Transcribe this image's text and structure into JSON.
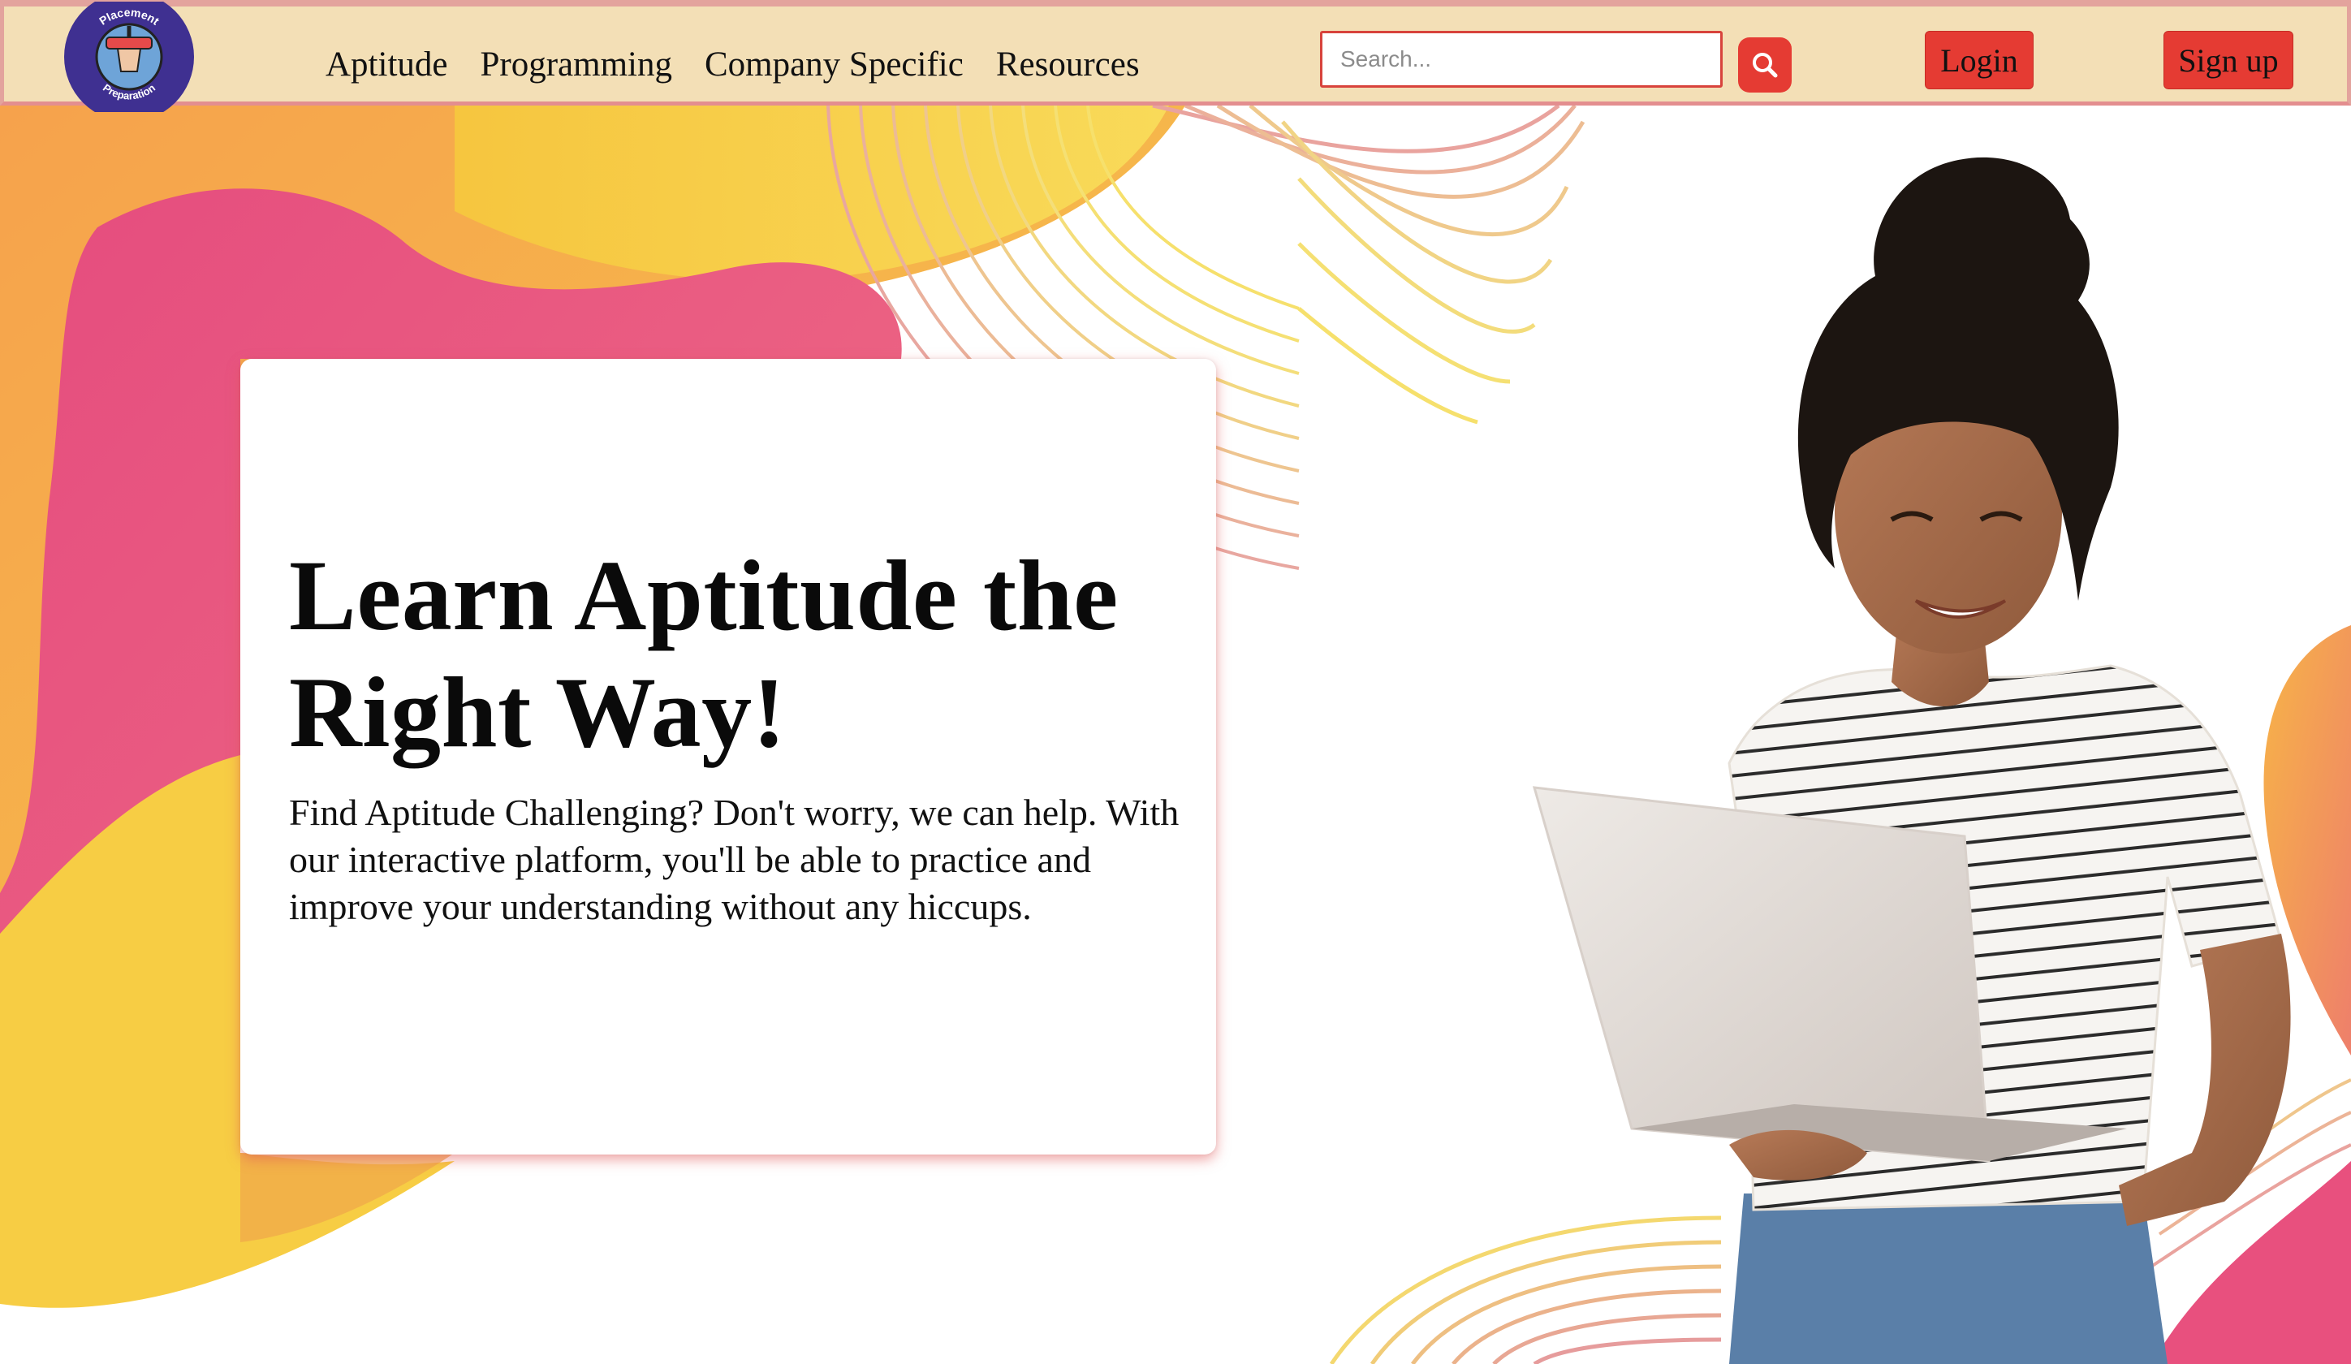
{
  "brand": {
    "logo_top_text": "Placement",
    "logo_bottom_text": "Preparation"
  },
  "nav": {
    "links": [
      {
        "label": "Aptitude"
      },
      {
        "label": "Programming"
      },
      {
        "label": "Company Specific"
      },
      {
        "label": "Resources"
      }
    ]
  },
  "search": {
    "placeholder": "Search...",
    "value": "",
    "button_icon": "search-icon"
  },
  "auth": {
    "login_label": "Login",
    "signup_label": "Sign up"
  },
  "hero": {
    "title": "Learn Aptitude the Right Way!",
    "description": "Find Aptitude Challenging? Don't worry, we can help. With our interactive platform, you'll be able to practice and improve your understanding without any hiccups."
  },
  "colors": {
    "navbar_bg": "#f3dfb6",
    "accent_red": "#e53b33",
    "logo_purple": "#3f3091",
    "wave_pink": "#e85285",
    "wave_yellow": "#f7cf45",
    "wave_orange": "#f29c4a"
  },
  "images": {
    "hero_person": "woman-with-laptop-illustration"
  }
}
